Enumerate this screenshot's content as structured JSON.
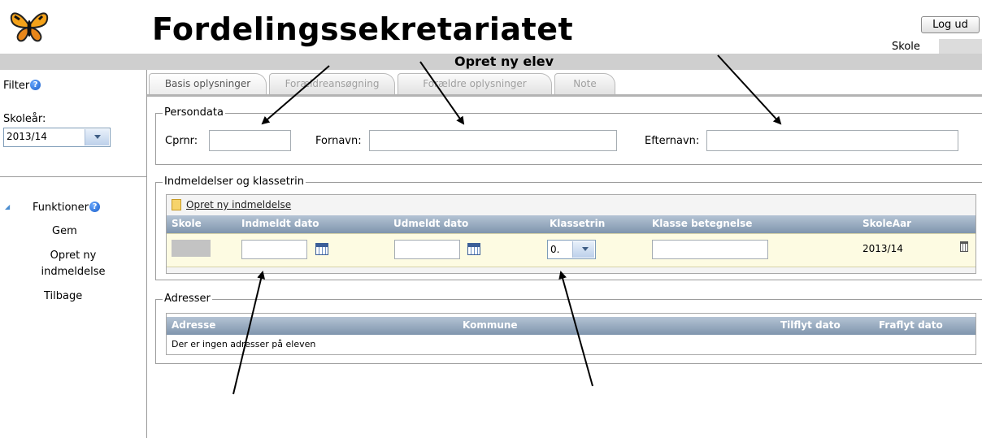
{
  "header": {
    "app_title": "Fordelingssekretariatet",
    "logout_label": "Log ud",
    "school_label": "Skole",
    "page_title": "Opret ny elev"
  },
  "sidebar": {
    "filter_label": "Filter",
    "school_year_label": "Skoleår:",
    "school_year_value": "2013/14",
    "functions_label": "Funktioner",
    "items": [
      {
        "label": "Gem"
      },
      {
        "label": "Opret ny indmeldelse"
      },
      {
        "label": "Tilbage"
      }
    ]
  },
  "tabs": [
    {
      "label": "Basis oplysninger",
      "active": true
    },
    {
      "label": "Forældreansøgning",
      "active": false
    },
    {
      "label": "Forældre oplysninger",
      "active": false
    },
    {
      "label": "Note",
      "active": false
    }
  ],
  "persondata": {
    "legend": "Persondata",
    "cprnr_label": "Cprnr:",
    "fornavn_label": "Fornavn:",
    "efternavn_label": "Efternavn:",
    "cprnr_value": "",
    "fornavn_value": "",
    "efternavn_value": ""
  },
  "enrollment": {
    "legend": "Indmeldelser og klassetrin",
    "create_link": "Opret ny indmeldelse",
    "columns": [
      "Skole",
      "Indmeldt dato",
      "Udmeldt dato",
      "Klassetrin",
      "Klasse betegnelse",
      "SkoleAar"
    ],
    "row": {
      "indmeldt_dato": "",
      "udmeldt_dato": "",
      "klassetrin": "0.",
      "klasse_betegnelse": "",
      "skoleaar": "2013/14"
    }
  },
  "addresses": {
    "legend": "Adresser",
    "columns": [
      "Adresse",
      "Kommune",
      "Tilflyt dato",
      "Fraflyt dato"
    ],
    "empty_text": "Der er ingen adresser på eleven"
  },
  "colors": {
    "grid_header": "#8ea2b9",
    "row_highlight": "#fdfbe2",
    "title_bar": "#cfcfcf"
  }
}
